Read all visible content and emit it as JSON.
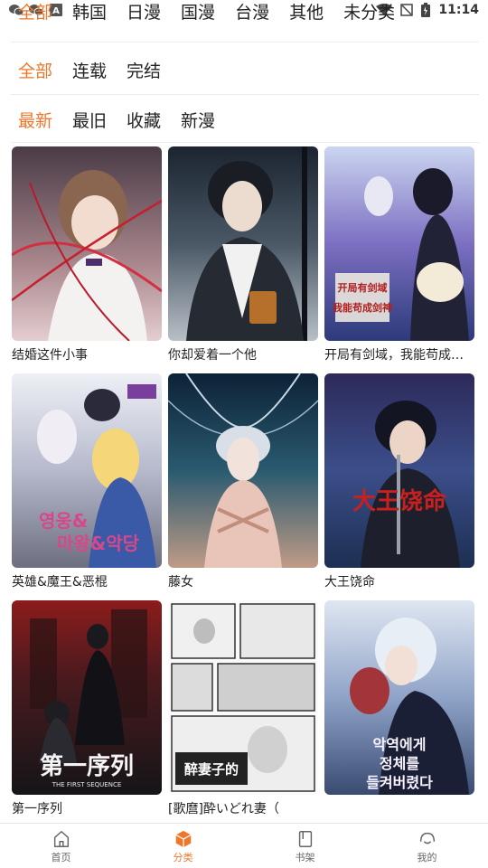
{
  "status_bar": {
    "time": "11:14",
    "notification_icons": [
      "wechat-icon",
      "wechat-icon",
      "a-icon"
    ],
    "system_icons": [
      "wifi-icon",
      "no-sim-icon",
      "battery-icon"
    ]
  },
  "filters": {
    "region": [
      "全部",
      "韩国",
      "日漫",
      "国漫",
      "台漫",
      "其他",
      "未分类"
    ],
    "region_active": 0,
    "status": [
      "全部",
      "连载",
      "完结"
    ],
    "status_active": 0,
    "sort": [
      "最新",
      "最旧",
      "收藏",
      "新漫"
    ],
    "sort_active": 0
  },
  "comics": [
    {
      "title": "结婚这件小事",
      "cover": "portrait-man-red-threads"
    },
    {
      "title": "你却爱着一个他",
      "cover": "portrait-man-dark"
    },
    {
      "title": "开局有剑域，我能苟成剑神",
      "cover": "swordsman-with-wolf"
    },
    {
      "title": "英雄&魔王&恶棍",
      "cover": "fantasy-heroes"
    },
    {
      "title": "藤女",
      "cover": "vine-woman"
    },
    {
      "title": "大王饶命",
      "cover": "king-spare-my-life"
    },
    {
      "title": "第一序列",
      "cover": "the-first-sequence"
    },
    {
      "title": "[歌麿]酔いどれ妻（",
      "cover": "manga-page"
    },
    {
      "title": "",
      "cover": "romance-duke"
    }
  ],
  "cover_text": {
    "c3": "开局有剑域\n我能苟成剑神",
    "c4": "영웅&마왕&악당",
    "c6": "大王饶命",
    "c7_main": "第一序列",
    "c7_sub": "THE FIRST SEQUENCE",
    "c9": "악역에게 정체를 들켜버렸다"
  },
  "bottom_nav": [
    {
      "label": "首页",
      "icon": "home-icon"
    },
    {
      "label": "分类",
      "icon": "category-icon"
    },
    {
      "label": "书架",
      "icon": "bookshelf-icon"
    },
    {
      "label": "我的",
      "icon": "profile-icon"
    }
  ],
  "bottom_nav_active": 1,
  "colors": {
    "accent": "#f0762a",
    "text": "#222222",
    "muted": "#666666"
  }
}
